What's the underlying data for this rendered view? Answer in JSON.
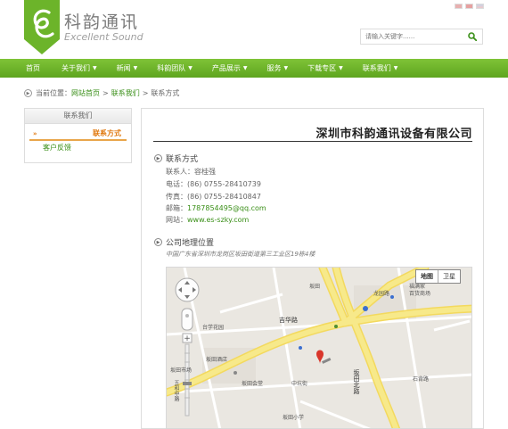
{
  "header": {
    "logo_cn": "科韵通讯",
    "logo_en": "Excellent Sound",
    "flags": [
      "flag-cn-icon",
      "flag-hk-icon",
      "flag-en-icon"
    ],
    "search_placeholder": "请输入关键字......",
    "brand_color": "#6cb42a"
  },
  "nav": {
    "items": [
      {
        "label": "首页",
        "has_arrow": false
      },
      {
        "label": "关于我们",
        "has_arrow": true
      },
      {
        "label": "新闻",
        "has_arrow": true
      },
      {
        "label": "科韵团队",
        "has_arrow": true
      },
      {
        "label": "产品展示",
        "has_arrow": true
      },
      {
        "label": "服务",
        "has_arrow": true
      },
      {
        "label": "下载专区",
        "has_arrow": true
      },
      {
        "label": "联系我们",
        "has_arrow": true
      }
    ],
    "arrow_glyph": "▼"
  },
  "breadcrumb": {
    "prefix": "当前位置：",
    "home": "网站首页",
    "sep": ">",
    "parent": "联系我们",
    "current": "联系方式"
  },
  "sidebar": {
    "title": "联系我们",
    "items": [
      {
        "label": "联系方式",
        "active": true
      },
      {
        "label": "客户反馈",
        "active": false
      }
    ]
  },
  "content": {
    "company": "深圳市科韵通讯设备有限公司",
    "contact_heading": "联系方式",
    "contact": {
      "person_label": "联系人：",
      "person": "容桂强",
      "phone_label": "电话：",
      "phone": "(86) 0755-28410739",
      "fax_label": "传真：",
      "fax": "(86) 0755-28410847",
      "email_label": "邮箱：",
      "email": "1787854495@qq.com",
      "site_label": "网站：",
      "site": "www.es-szky.com"
    },
    "location_heading": "公司地理位置",
    "address": "中国广东省深圳市龙岗区坂田街道第三工业区19栋4楼"
  },
  "map": {
    "btn_map": "地图",
    "btn_satellite": "卫星",
    "labels": [
      {
        "id": "road-1",
        "text": "坂田"
      },
      {
        "id": "road-2",
        "text": "吉华路"
      },
      {
        "id": "road-3",
        "text": "龙园路"
      },
      {
        "id": "road-4",
        "text": "福满家"
      },
      {
        "id": "road-5",
        "text": "百货商场"
      },
      {
        "id": "road-6",
        "text": "台学花园"
      },
      {
        "id": "road-7",
        "text": "坂田酒店"
      },
      {
        "id": "road-8",
        "text": "坂田北路"
      },
      {
        "id": "road-9",
        "text": "坂田会堂"
      },
      {
        "id": "road-10",
        "text": "中坑街"
      },
      {
        "id": "road-11",
        "text": "石背路"
      },
      {
        "id": "road-12",
        "text": "坂田小学"
      },
      {
        "id": "road-13",
        "text": "五和中路"
      },
      {
        "id": "road-14",
        "text": "坂田市场"
      }
    ],
    "road_color": "#f7e98a",
    "land_color": "#eae7e1"
  }
}
